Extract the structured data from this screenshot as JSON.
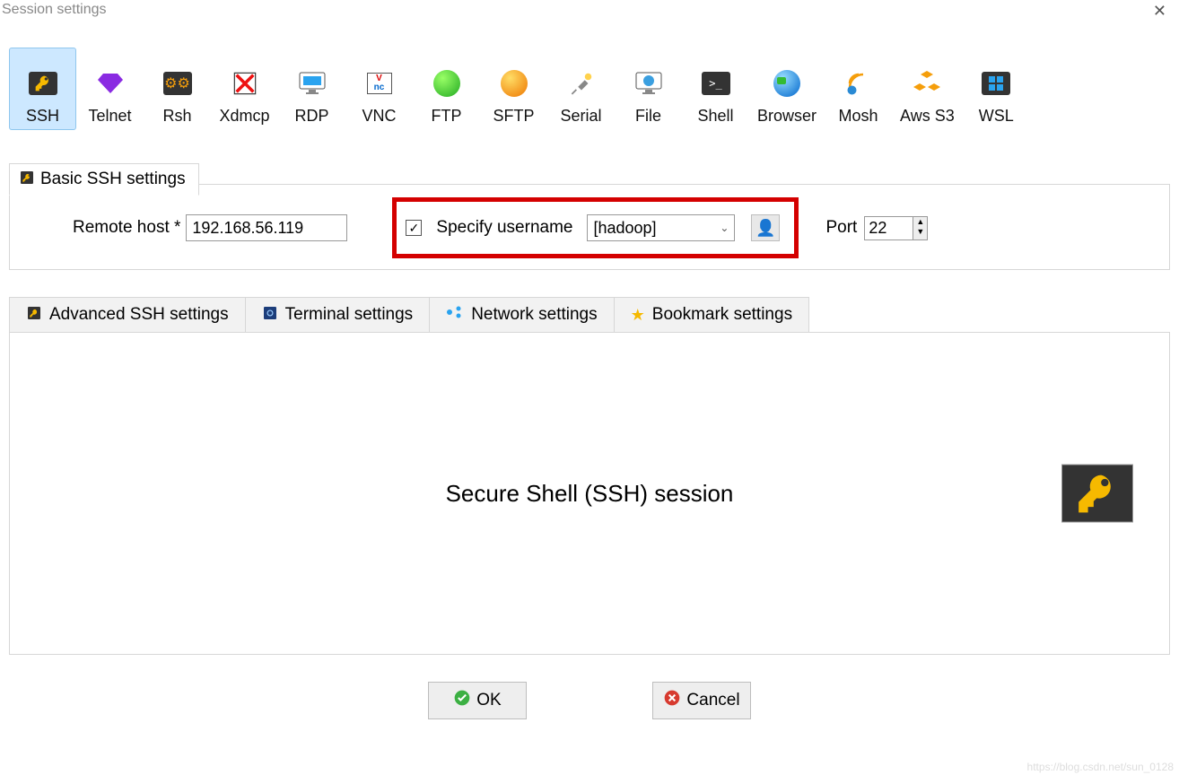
{
  "title": "Session settings",
  "session_types": [
    {
      "label": "SSH"
    },
    {
      "label": "Telnet"
    },
    {
      "label": "Rsh"
    },
    {
      "label": "Xdmcp"
    },
    {
      "label": "RDP"
    },
    {
      "label": "VNC"
    },
    {
      "label": "FTP"
    },
    {
      "label": "SFTP"
    },
    {
      "label": "Serial"
    },
    {
      "label": "File"
    },
    {
      "label": "Shell"
    },
    {
      "label": "Browser"
    },
    {
      "label": "Mosh"
    },
    {
      "label": "Aws S3"
    },
    {
      "label": "WSL"
    }
  ],
  "basic": {
    "legend": "Basic SSH settings",
    "remote_host_label": "Remote host *",
    "remote_host_value": "192.168.56.119",
    "specify_username_label": "Specify username",
    "specify_username_checked": true,
    "username_value": "[hadoop]",
    "port_label": "Port",
    "port_value": "22"
  },
  "settings_tabs": {
    "advanced": "Advanced SSH settings",
    "terminal": "Terminal settings",
    "network": "Network settings",
    "bookmark": "Bookmark settings"
  },
  "body_title": "Secure Shell (SSH) session",
  "buttons": {
    "ok": "OK",
    "cancel": "Cancel"
  },
  "watermark": "https://blog.csdn.net/sun_0128"
}
